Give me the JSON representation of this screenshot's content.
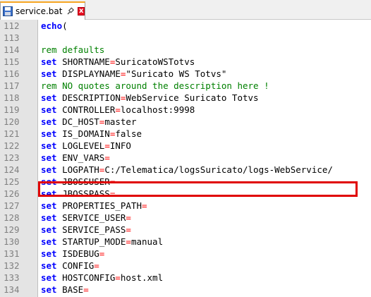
{
  "tab": {
    "filename": "service.bat",
    "close_glyph": "x"
  },
  "editor": {
    "lines": [
      {
        "num": "112",
        "parts": [
          {
            "t": "kw",
            "v": "echo"
          },
          {
            "t": "tx",
            "v": "("
          }
        ]
      },
      {
        "num": "113",
        "parts": []
      },
      {
        "num": "114",
        "parts": [
          {
            "t": "cm",
            "v": "rem defaults"
          }
        ]
      },
      {
        "num": "115",
        "parts": [
          {
            "t": "kw",
            "v": "set"
          },
          {
            "t": "tx",
            "v": " SHORTNAME"
          },
          {
            "t": "op",
            "v": "="
          },
          {
            "t": "tx",
            "v": "SuricatoWSTotvs"
          }
        ]
      },
      {
        "num": "116",
        "parts": [
          {
            "t": "kw",
            "v": "set"
          },
          {
            "t": "tx",
            "v": " DISPLAYNAME"
          },
          {
            "t": "op",
            "v": "="
          },
          {
            "t": "tx",
            "v": "\"Suricato WS Totvs\""
          }
        ]
      },
      {
        "num": "117",
        "parts": [
          {
            "t": "cm",
            "v": "rem NO quotes around the description here !"
          }
        ]
      },
      {
        "num": "118",
        "parts": [
          {
            "t": "kw",
            "v": "set"
          },
          {
            "t": "tx",
            "v": " DESCRIPTION"
          },
          {
            "t": "op",
            "v": "="
          },
          {
            "t": "tx",
            "v": "WebService Suricato Totvs"
          }
        ]
      },
      {
        "num": "119",
        "parts": [
          {
            "t": "kw",
            "v": "set"
          },
          {
            "t": "tx",
            "v": " CONTROLLER"
          },
          {
            "t": "op",
            "v": "="
          },
          {
            "t": "tx",
            "v": "localhost:9998"
          }
        ]
      },
      {
        "num": "120",
        "parts": [
          {
            "t": "kw",
            "v": "set"
          },
          {
            "t": "tx",
            "v": " DC_HOST"
          },
          {
            "t": "op",
            "v": "="
          },
          {
            "t": "tx",
            "v": "master"
          }
        ]
      },
      {
        "num": "121",
        "parts": [
          {
            "t": "kw",
            "v": "set"
          },
          {
            "t": "tx",
            "v": " IS_DOMAIN"
          },
          {
            "t": "op",
            "v": "="
          },
          {
            "t": "tx",
            "v": "false"
          }
        ]
      },
      {
        "num": "122",
        "parts": [
          {
            "t": "kw",
            "v": "set"
          },
          {
            "t": "tx",
            "v": " LOGLEVEL"
          },
          {
            "t": "op",
            "v": "="
          },
          {
            "t": "tx",
            "v": "INFO"
          }
        ]
      },
      {
        "num": "123",
        "parts": [
          {
            "t": "kw",
            "v": "set"
          },
          {
            "t": "tx",
            "v": " ENV_VARS"
          },
          {
            "t": "op",
            "v": "="
          }
        ]
      },
      {
        "num": "124",
        "parts": [
          {
            "t": "kw",
            "v": "set"
          },
          {
            "t": "tx",
            "v": " LOGPATH"
          },
          {
            "t": "op",
            "v": "="
          },
          {
            "t": "tx",
            "v": "C:/Telematica/logsSuricato/logs-WebService/"
          }
        ]
      },
      {
        "num": "125",
        "parts": [
          {
            "t": "kw",
            "v": "set"
          },
          {
            "t": "tx",
            "v": " JBOSSUSER"
          },
          {
            "t": "op",
            "v": "="
          }
        ]
      },
      {
        "num": "126",
        "parts": [
          {
            "t": "kw",
            "v": "set"
          },
          {
            "t": "tx",
            "v": " JBOSSPASS"
          },
          {
            "t": "op",
            "v": "="
          }
        ]
      },
      {
        "num": "127",
        "parts": [
          {
            "t": "kw",
            "v": "set"
          },
          {
            "t": "tx",
            "v": " PROPERTIES_PATH"
          },
          {
            "t": "op",
            "v": "="
          }
        ]
      },
      {
        "num": "128",
        "parts": [
          {
            "t": "kw",
            "v": "set"
          },
          {
            "t": "tx",
            "v": " SERVICE_USER"
          },
          {
            "t": "op",
            "v": "="
          }
        ]
      },
      {
        "num": "129",
        "parts": [
          {
            "t": "kw",
            "v": "set"
          },
          {
            "t": "tx",
            "v": " SERVICE_PASS"
          },
          {
            "t": "op",
            "v": "="
          }
        ]
      },
      {
        "num": "130",
        "parts": [
          {
            "t": "kw",
            "v": "set"
          },
          {
            "t": "tx",
            "v": " STARTUP_MODE"
          },
          {
            "t": "op",
            "v": "="
          },
          {
            "t": "tx",
            "v": "manual"
          }
        ]
      },
      {
        "num": "131",
        "parts": [
          {
            "t": "kw",
            "v": "set"
          },
          {
            "t": "tx",
            "v": " ISDEBUG"
          },
          {
            "t": "op",
            "v": "="
          }
        ]
      },
      {
        "num": "132",
        "parts": [
          {
            "t": "kw",
            "v": "set"
          },
          {
            "t": "tx",
            "v": " CONFIG"
          },
          {
            "t": "op",
            "v": "="
          }
        ]
      },
      {
        "num": "133",
        "parts": [
          {
            "t": "kw",
            "v": "set"
          },
          {
            "t": "tx",
            "v": " HOSTCONFIG"
          },
          {
            "t": "op",
            "v": "="
          },
          {
            "t": "tx",
            "v": "host.xml"
          }
        ]
      },
      {
        "num": "134",
        "parts": [
          {
            "t": "kw",
            "v": "set"
          },
          {
            "t": "tx",
            "v": " BASE"
          },
          {
            "t": "op",
            "v": "="
          }
        ]
      }
    ],
    "highlighted_line": "124",
    "colors": {
      "keyword": "#0000ff",
      "comment": "#008000",
      "operator": "#ff0000",
      "highlight_border": "#e00000",
      "gutter_bg": "#e4e4e4"
    }
  }
}
